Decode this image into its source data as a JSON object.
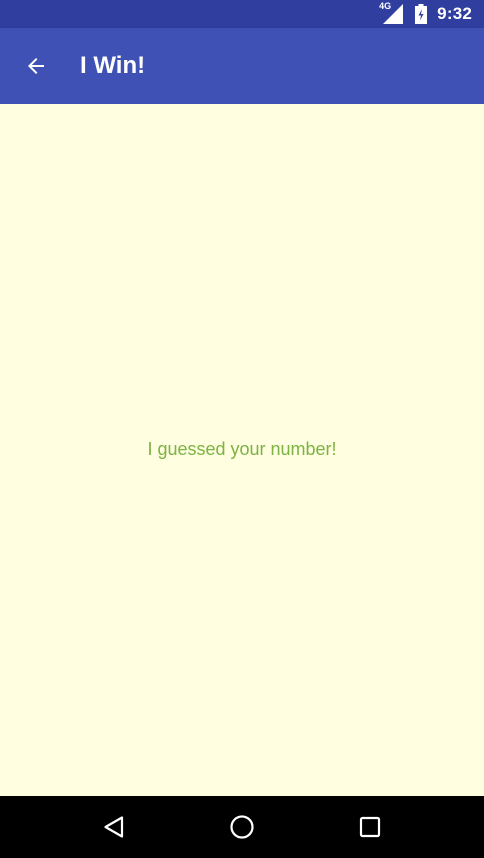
{
  "status_bar": {
    "network_label": "4G",
    "time": "9:32"
  },
  "app_bar": {
    "title": "I Win!",
    "back_icon": "arrow-back-icon"
  },
  "main": {
    "message": "I guessed your number!"
  },
  "nav_bar": {
    "back_icon": "nav-back-icon",
    "home_icon": "nav-home-icon",
    "recents_icon": "nav-recents-icon"
  },
  "colors": {
    "status_bar": "#303f9f",
    "app_bar": "#3f51b5",
    "background": "#fffee0",
    "message_text": "#7cb342",
    "nav_bar": "#000000"
  }
}
